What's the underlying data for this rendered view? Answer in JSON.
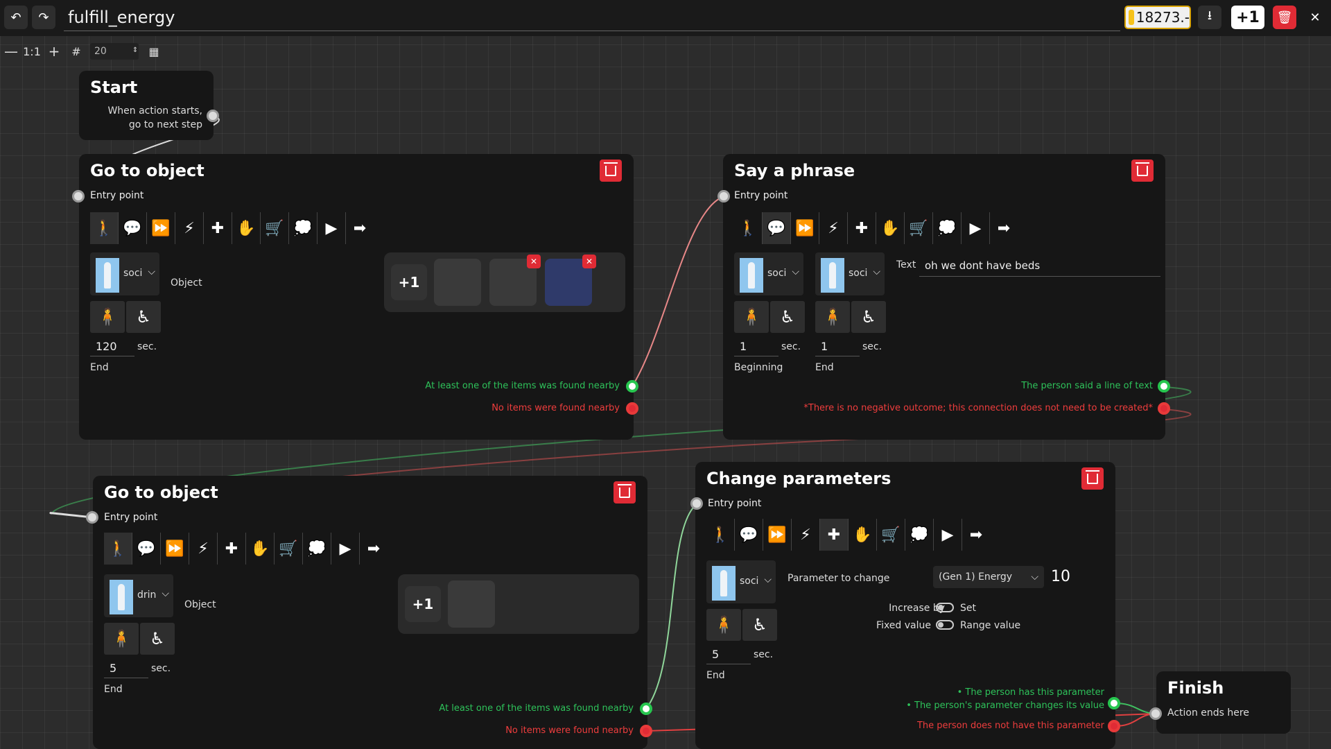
{
  "topbar": {
    "title": "fulfill_energy",
    "coins": "18273.-",
    "plus_label": "+1"
  },
  "toolbar": {
    "zoom_reset": "1:1",
    "grid_size": "20"
  },
  "nodes": {
    "start": {
      "title": "Start",
      "text": "When action starts, go to next step"
    },
    "go_to_object_1": {
      "title": "Go to object",
      "entry": "Entry point",
      "avatar": "soci",
      "object_label": "Object",
      "plus_label": "+1",
      "seconds": "120",
      "sec_label": "sec.",
      "time_label": "End",
      "out_found": "At least one of the items was found nearby",
      "out_none": "No items were found nearby"
    },
    "say_phrase": {
      "title": "Say a phrase",
      "entry": "Entry point",
      "avatar1": "soci",
      "avatar2": "soci",
      "text_label": "Text",
      "text_value": "oh we dont have beds",
      "sec1": "1",
      "sec2": "1",
      "sec_label": "sec.",
      "time1_label": "Beginning",
      "time2_label": "End",
      "out_said": "The person said a line of text",
      "out_neg": "*There is no negative outcome; this connection does not need to be created*"
    },
    "go_to_object_2": {
      "title": "Go to object",
      "entry": "Entry point",
      "avatar": "drin",
      "object_label": "Object",
      "plus_label": "+1",
      "seconds": "5",
      "sec_label": "sec.",
      "time_label": "End",
      "out_found": "At least one of the items was found nearby",
      "out_none": "No items were found nearby"
    },
    "change_params": {
      "title": "Change parameters",
      "entry": "Entry point",
      "avatar": "soci",
      "param_label": "Parameter to change",
      "param_value": "(Gen 1) Energy",
      "amount": "10",
      "increase_by": "Increase by",
      "set": "Set",
      "fixed_value": "Fixed value",
      "range_value": "Range value",
      "seconds": "5",
      "sec_label": "sec.",
      "time_label": "End",
      "out_has": "• The person has this parameter",
      "out_changes": "• The person's parameter changes its value",
      "out_not": "The person does not have this parameter"
    },
    "finish": {
      "title": "Finish",
      "text": "Action ends here"
    }
  },
  "icons": [
    "walk-to-icon",
    "speech-text-icon",
    "fast-forward-icon",
    "split-icon",
    "plus-icon",
    "grab-icon",
    "cart-icon",
    "chat-bubble-icon",
    "play-timer-icon",
    "exit-sign-icon"
  ],
  "colors": {
    "accent_green": "#27c64f",
    "accent_red": "#e83a3a",
    "delete_red": "#e02b35",
    "node_bg": "#161616",
    "canvas_bg": "#2c2c2c"
  }
}
